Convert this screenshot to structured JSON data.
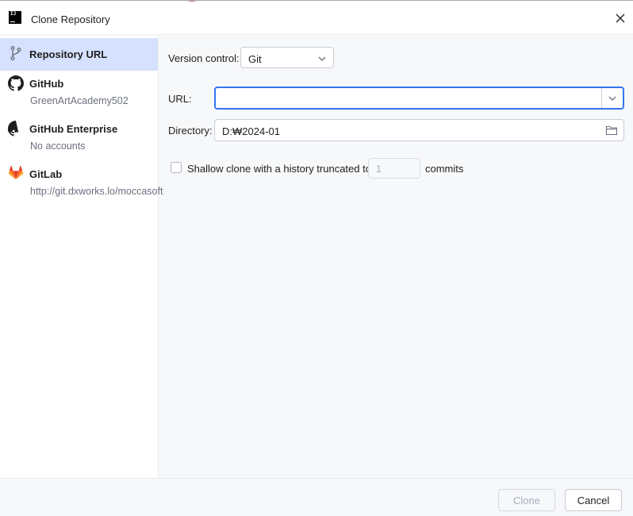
{
  "window": {
    "title": "Clone Repository",
    "close_icon": "close-icon",
    "accent_color": "#3574f0",
    "selection_color": "#d5e1ff"
  },
  "sidebar": {
    "items": [
      {
        "label": "Repository URL",
        "sub": "",
        "icon": "vcs-branch-icon"
      },
      {
        "label": "GitHub",
        "sub": "GreenArtAcademy502",
        "icon": "github-icon"
      },
      {
        "label": "GitHub Enterprise",
        "sub": "No accounts",
        "icon": "github-icon"
      },
      {
        "label": "GitLab",
        "sub": "http://git.dxworks.lo/moccasoft",
        "icon": "gitlab-icon"
      }
    ]
  },
  "form": {
    "version_control_label": "Version control:",
    "version_control_value": "Git",
    "url_label": "URL:",
    "url_value": "",
    "directory_label": "Directory:",
    "directory_value": "D:₩2024-01",
    "shallow_label": "Shallow clone with a history truncated to",
    "shallow_depth": "1",
    "commits_label": "commits",
    "shallow_checked": false
  },
  "footer": {
    "clone_label": "Clone",
    "cancel_label": "Cancel"
  }
}
